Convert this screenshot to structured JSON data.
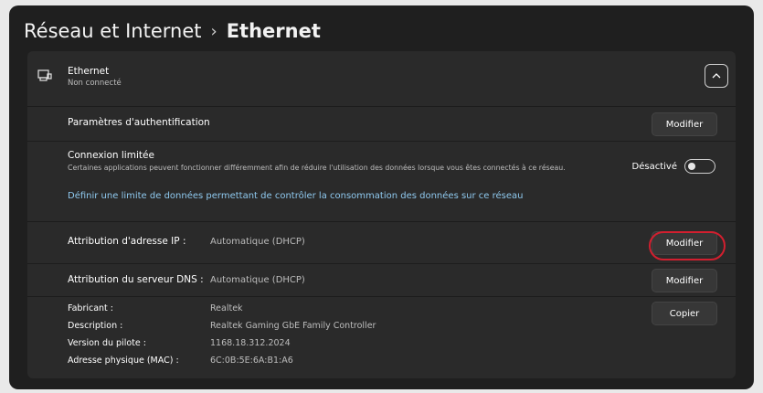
{
  "breadcrumb": {
    "parent": "Réseau et Internet",
    "separator": "›",
    "current": "Ethernet"
  },
  "header": {
    "title": "Ethernet",
    "subtitle": "Non connecté",
    "icon": "ethernet-icon",
    "chevron": "chevron-up-icon"
  },
  "auth": {
    "label": "Paramètres d'authentification",
    "button": "Modifier"
  },
  "metered": {
    "label": "Connexion limitée",
    "description": "Certaines applications peuvent fonctionner différemment afin de réduire l'utilisation des données lorsque vous êtes connectés à ce réseau.",
    "status": "Désactivé",
    "toggle_on": false,
    "link": "Définir une limite de données permettant de contrôler la consommation des données sur ce réseau"
  },
  "ip": {
    "label": "Attribution d'adresse IP :",
    "value": "Automatique (DHCP)",
    "button": "Modifier"
  },
  "dns": {
    "label": "Attribution du serveur DNS :",
    "value": "Automatique (DHCP)",
    "button": "Modifier"
  },
  "details": {
    "button": "Copier",
    "items": [
      {
        "label": "Fabricant :",
        "value": "Realtek"
      },
      {
        "label": "Description :",
        "value": "Realtek Gaming GbE Family Controller"
      },
      {
        "label": "Version du pilote :",
        "value": "1168.18.312.2024"
      },
      {
        "label": "Adresse physique (MAC) :",
        "value": "6C:0B:5E:6A:B1:A6"
      }
    ]
  },
  "colors": {
    "background": "#1f1f1f",
    "card": "#2a2a2a",
    "link": "#8fc9ef",
    "highlight": "#d21f2f"
  }
}
